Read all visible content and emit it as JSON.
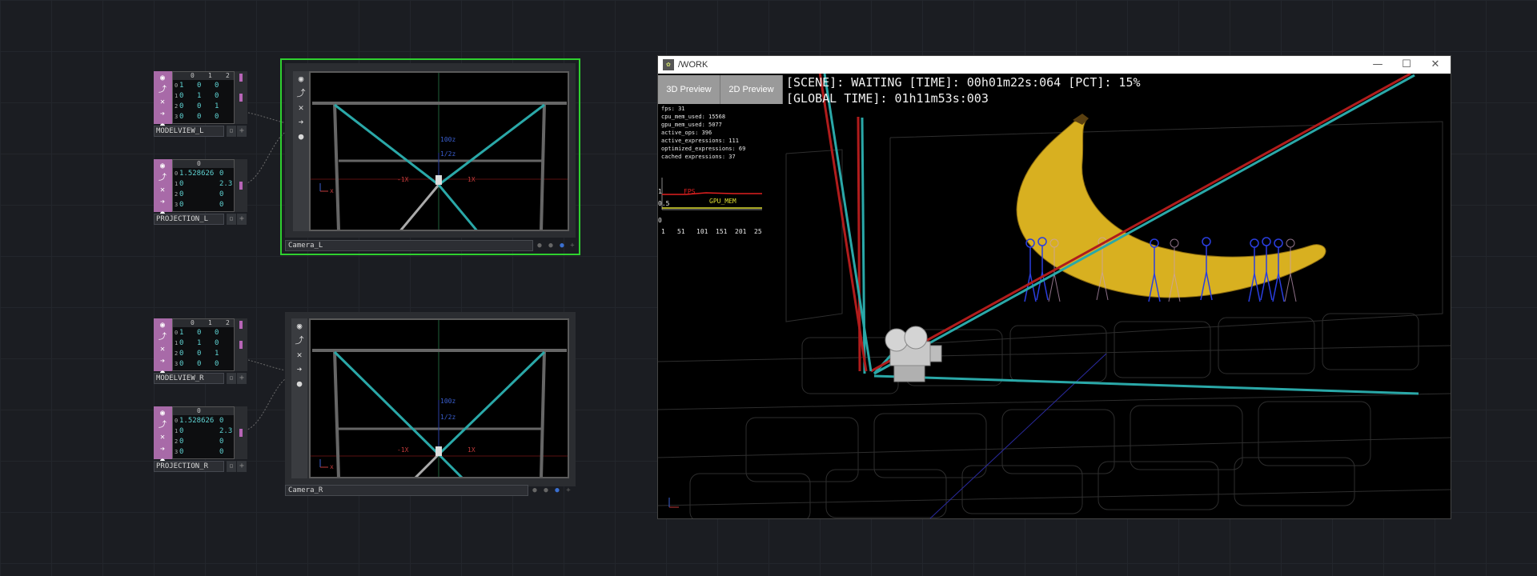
{
  "modelview_l": {
    "name": "MODELVIEW_L",
    "headers": [
      "0",
      "1",
      "2"
    ],
    "rows": [
      {
        "i": "0",
        "c0": "1",
        "c1": "0",
        "c2": "0"
      },
      {
        "i": "1",
        "c0": "0",
        "c1": "1",
        "c2": "0"
      },
      {
        "i": "2",
        "c0": "0",
        "c1": "0",
        "c2": "1"
      },
      {
        "i": "3",
        "c0": "0",
        "c1": "0",
        "c2": "0"
      }
    ]
  },
  "projection_l": {
    "name": "PROJECTION_L",
    "headers": [
      "0"
    ],
    "rows": [
      {
        "i": "0",
        "c0": "1.528626",
        "c2": "0"
      },
      {
        "i": "1",
        "c0": "0",
        "c2": "2.3"
      },
      {
        "i": "2",
        "c0": "0",
        "c2": "0"
      },
      {
        "i": "3",
        "c0": "0",
        "c2": "0"
      }
    ]
  },
  "modelview_r": {
    "name": "MODELVIEW_R",
    "headers": [
      "0",
      "1",
      "2"
    ],
    "rows": [
      {
        "i": "0",
        "c0": "1",
        "c1": "0",
        "c2": "0"
      },
      {
        "i": "1",
        "c0": "0",
        "c1": "1",
        "c2": "0"
      },
      {
        "i": "2",
        "c0": "0",
        "c1": "0",
        "c2": "1"
      },
      {
        "i": "3",
        "c0": "0",
        "c1": "0",
        "c2": "0"
      }
    ]
  },
  "projection_r": {
    "name": "PROJECTION_R",
    "headers": [
      "0"
    ],
    "rows": [
      {
        "i": "0",
        "c0": "1.528626",
        "c2": "0"
      },
      {
        "i": "1",
        "c0": "0",
        "c2": "2.3"
      },
      {
        "i": "2",
        "c0": "0",
        "c2": "0"
      },
      {
        "i": "3",
        "c0": "0",
        "c2": "0"
      }
    ]
  },
  "camera_l": {
    "name": "Camera_L",
    "axis_labels": {
      "y_top": "100z",
      "y_mid": "1/2z",
      "left": "-1X",
      "right": "1X",
      "x": "x"
    }
  },
  "camera_r": {
    "name": "Camera_R",
    "axis_labels": {
      "y_top": "100z",
      "y_mid": "1/2z",
      "left": "-1X",
      "right": "1X",
      "x": "x"
    }
  },
  "work_window": {
    "title": "/WORK",
    "minimize": "—",
    "maximize": "☐",
    "close": "✕",
    "btn_3d": "3D Preview",
    "btn_2d": "2D Preview",
    "status_line1": "[SCENE]: WAITING [TIME]: 00h01m22s:064 [PCT]: 15%",
    "status_line2": "[GLOBAL TIME]: 01h11m53s:003",
    "perf": [
      "fps: 31",
      "cpu_mem_used: 15568",
      "gpu_mem_used: 5077",
      "active_ops: 396",
      "active_expressions: 111",
      "optimized_expressions: 69",
      "cached expressions: 37"
    ],
    "graph": {
      "fps_label": "FPS",
      "gpu_label": "GPU_MEM",
      "y_top": "1",
      "y_mid": "0.5",
      "y_bot": "0",
      "x_ticks": [
        "1",
        "51",
        "101",
        "151",
        "201",
        "25"
      ]
    }
  },
  "colors": {
    "node_pink": "#a86aa8",
    "selected_border": "#2fd02f",
    "teal": "#2aa8a8",
    "red": "#b01c1c"
  }
}
